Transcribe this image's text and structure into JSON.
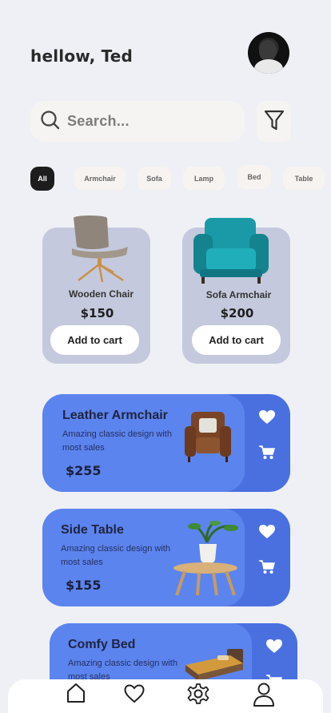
{
  "header": {
    "greeting": "hellow, Ted"
  },
  "search": {
    "placeholder": "Search..."
  },
  "categories": [
    "All",
    "Armchair",
    "Sofa",
    "Lamp",
    "Bed",
    "Table"
  ],
  "featured": [
    {
      "name": "Wooden Chair",
      "price": "$150",
      "button": "Add to cart"
    },
    {
      "name": "Sofa Armchair",
      "price": "$200",
      "button": "Add to cart"
    }
  ],
  "list": [
    {
      "name": "Leather Armchair",
      "description": "Amazing classic design with most sales",
      "price": "$255"
    },
    {
      "name": "Side Table",
      "description": "Amazing classic design with most sales",
      "price": "$155"
    },
    {
      "name": "Comfy Bed",
      "description": "Amazing classic design with most sales",
      "price": ""
    }
  ],
  "nav": [
    "home-icon",
    "heart-icon",
    "settings-icon",
    "profile-icon"
  ],
  "colors": {
    "background": "#eef0f5",
    "card_blue": "#4a70e0",
    "card_inner": "#5c84ee",
    "featured_card": "#c4c9dd",
    "chip_active": "#1d1d1d"
  }
}
